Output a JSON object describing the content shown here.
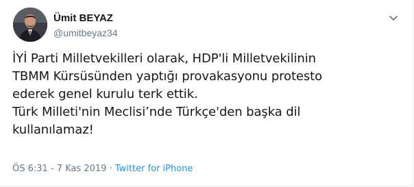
{
  "tweet": {
    "author": {
      "display_name": "Ümit BEYAZ",
      "handle": "@umitbeyaz34"
    },
    "text_lines": [
      "İYİ Parti Milletvekilleri olarak, HDP'li Milletvekilinin",
      "TBMM Kürsüsünden yaptığı provakasyonu protesto",
      "ederek genel kurulu terk ettik.",
      "Türk Milleti'nin Meclisi’nde Türkçe'den başka dil",
      "kullanılamaz!"
    ],
    "timestamp": "ÖS 6:31 - 7 Kas 2019",
    "separator": "·",
    "source": "Twitter for iPhone"
  },
  "icons": {
    "avatar": "profile-photo",
    "menu": "chevron-down-icon"
  },
  "colors": {
    "text": "#14171a",
    "muted": "#657786",
    "link": "#1b95e0",
    "border": "#e6ecf0"
  }
}
